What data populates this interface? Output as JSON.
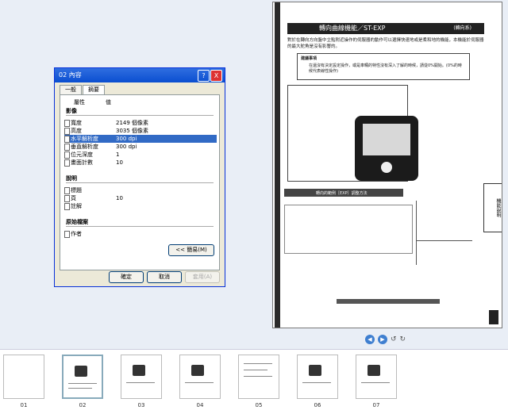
{
  "dialog": {
    "title": "02 內容",
    "help_label": "?",
    "close_label": "X",
    "tabs": [
      "一般",
      "摘要"
    ],
    "header": {
      "property": "屬性",
      "value": "值"
    },
    "sections": {
      "image": "影像",
      "description": "說明",
      "origin": "原始檔案"
    },
    "image_props": [
      {
        "key": "寬度",
        "value": "2149 個像素"
      },
      {
        "key": "高度",
        "value": "3035 個像素"
      },
      {
        "key": "水平解析度",
        "value": "300 dpi"
      },
      {
        "key": "垂直解析度",
        "value": "300 dpi"
      },
      {
        "key": "位元深度",
        "value": "1"
      },
      {
        "key": "畫面計數",
        "value": "10"
      }
    ],
    "desc_props": [
      {
        "key": "標題",
        "value": ""
      },
      {
        "key": "頁",
        "value": "10"
      },
      {
        "key": "註解",
        "value": ""
      }
    ],
    "origin_props": [
      {
        "key": "作者",
        "value": ""
      }
    ],
    "advanced_label": "<< 簡易(M)",
    "ok_label": "確定",
    "cancel_label": "取消",
    "apply_label": "套用(A)"
  },
  "document": {
    "title": "轉向曲線機能／ST-EXP",
    "title_sub": "(轉向系)",
    "intro": "對於在轉向方向盤中立點附近操作的伺服器的動作可以選擇快速地或是柔和地的機能，本機能於伺服器的最大舵角是沒有影響的。",
    "note_heading": "建議事項",
    "note": "在還沒有決定設定操作，或是車輛的特性沒有深入了解的時候，請從0%開始。(0%的時候代表線性操作)",
    "section2": "轉向的範例［EXP］調整方法",
    "side_tab": "機能說明"
  },
  "thumbnails": [
    "01",
    "02",
    "03",
    "04",
    "05",
    "06",
    "07"
  ],
  "colors": {
    "titlebar": "#0a4ed0",
    "selection": "#316ac5",
    "dialog_bg": "#ece9d8"
  }
}
